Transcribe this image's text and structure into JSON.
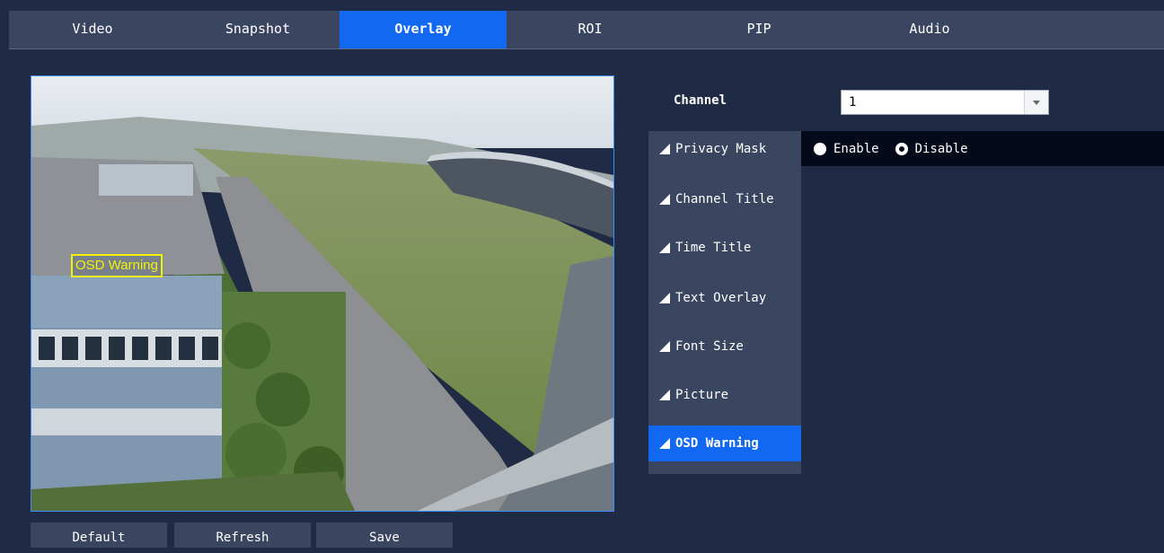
{
  "tabs": [
    {
      "label": "Video",
      "active": false
    },
    {
      "label": "Snapshot",
      "active": false
    },
    {
      "label": "Overlay",
      "active": true
    },
    {
      "label": "ROI",
      "active": false
    },
    {
      "label": "PIP",
      "active": false
    },
    {
      "label": "Audio",
      "active": false
    }
  ],
  "preview": {
    "osd_label": "OSD Warning"
  },
  "buttons": {
    "default": "Default",
    "refresh": "Refresh",
    "save": "Save"
  },
  "channel": {
    "label": "Channel",
    "value": "1"
  },
  "menu": [
    {
      "label": "Privacy Mask",
      "active": false
    },
    {
      "label": "Channel Title",
      "active": false
    },
    {
      "label": "Time Title",
      "active": false
    },
    {
      "label": "Text Overlay",
      "active": false
    },
    {
      "label": "Font Size",
      "active": false
    },
    {
      "label": "Picture",
      "active": false
    },
    {
      "label": "OSD Warning",
      "active": true
    }
  ],
  "options": {
    "enable_label": "Enable",
    "disable_label": "Disable",
    "selected": "disable"
  },
  "colors": {
    "accent": "#1268f0",
    "background": "#1f2a44",
    "panel": "#3a4660",
    "osd_box": "#f2f20a"
  }
}
